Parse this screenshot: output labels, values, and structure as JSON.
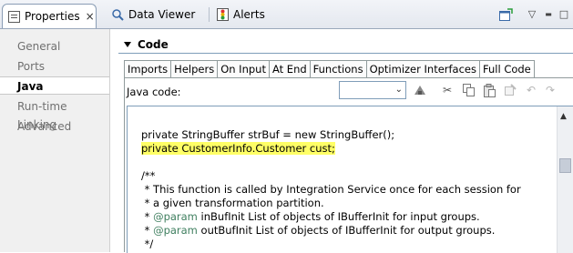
{
  "view_tabs": [
    {
      "label": "Properties",
      "icon": "properties-icon",
      "close": "×"
    },
    {
      "label": "Data Viewer",
      "icon": "data-viewer-icon"
    },
    {
      "label": "Alerts",
      "icon": "alerts-icon"
    }
  ],
  "view_toolbar": {
    "new_window_icon": "new-window-icon",
    "menu_glyph": "▽",
    "minimize_glyph": "▬",
    "maximize_glyph": "□"
  },
  "nav": {
    "items": [
      "General",
      "Ports",
      "Java",
      "Run-time Linking",
      "Advanced"
    ],
    "active": "Java"
  },
  "section": {
    "title": "Code"
  },
  "code_tabs": {
    "items": [
      "Imports",
      "Helpers",
      "On Input",
      "At End",
      "Functions",
      "Optimizer Interfaces",
      "Full Code"
    ],
    "active": "Full Code"
  },
  "editor": {
    "label": "Java code:",
    "combo_value": "",
    "code_lines": [
      {
        "text": "private StringBuffer strBuf = new StringBuffer();"
      },
      {
        "text": "private CustomerInfo.Customer cust;",
        "highlight": true
      },
      {
        "text": ""
      },
      {
        "text": "/**"
      },
      {
        "text": " * This function is called by Integration Service once for each session for"
      },
      {
        "text": " * a given transformation partition."
      },
      {
        "pre": " * ",
        "tag": "@param",
        "post": " inBufInit List of objects of IBufferInit for input groups."
      },
      {
        "pre": " * ",
        "tag": "@param",
        "post": " outBufInit List of objects of IBufferInit for output groups."
      },
      {
        "text": " */"
      }
    ]
  },
  "colors": {
    "highlight": "#ffff66",
    "javadoc_tag": "#3f7f5f",
    "inactive_nav_text": "#707070"
  }
}
